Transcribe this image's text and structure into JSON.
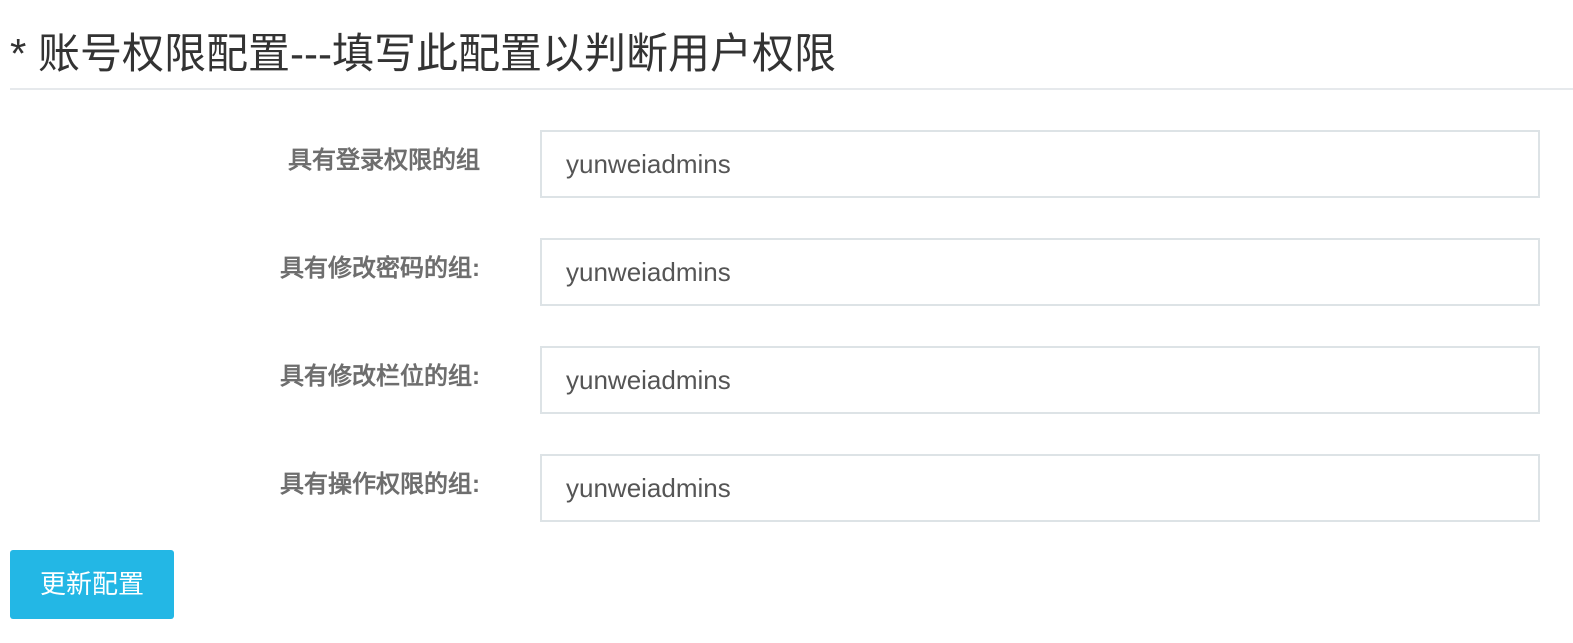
{
  "page_title": "* 账号权限配置---填写此配置以判断用户权限",
  "fields": [
    {
      "label": "具有登录权限的组",
      "value": "yunweiadmins"
    },
    {
      "label": "具有修改密码的组:",
      "value": "yunweiadmins"
    },
    {
      "label": "具有修改栏位的组:",
      "value": "yunweiadmins"
    },
    {
      "label": "具有操作权限的组:",
      "value": "yunweiadmins"
    }
  ],
  "update_button_label": "更新配置",
  "colors": {
    "primary": "#23b7e5",
    "input_border": "#dde3e6",
    "label": "#6e6e6e",
    "title": "#333333"
  }
}
